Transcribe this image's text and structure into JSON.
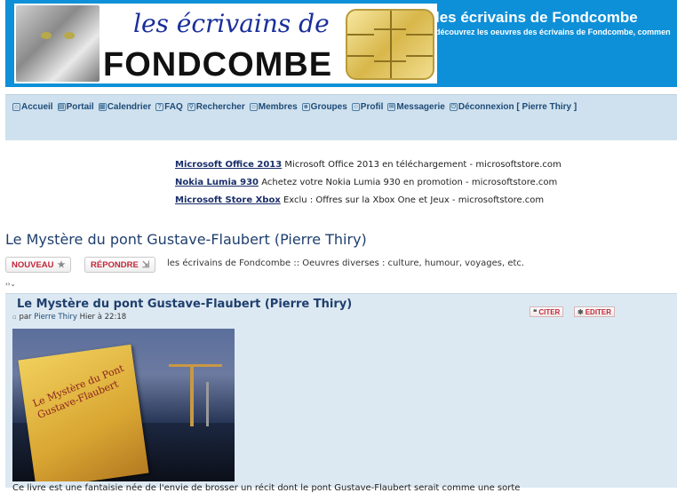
{
  "header": {
    "logo_top_text": "les écrivains de",
    "logo_main_text": "FONDCOMBE",
    "site_title": "les écrivains de Fondcombe",
    "site_subtitle": "découvrez les oeuvres des écrivains de Fondcombe, commen"
  },
  "nav": {
    "items": [
      {
        "label": "Accueil",
        "icon": "home-icon"
      },
      {
        "label": "Portail",
        "icon": "portal-icon"
      },
      {
        "label": "Calendrier",
        "icon": "calendar-icon"
      },
      {
        "label": "FAQ",
        "icon": "faq-icon"
      },
      {
        "label": "Rechercher",
        "icon": "search-icon"
      },
      {
        "label": "Membres",
        "icon": "members-icon"
      },
      {
        "label": "Groupes",
        "icon": "groups-icon"
      },
      {
        "label": "Profil",
        "icon": "profile-icon"
      },
      {
        "label": "Messagerie",
        "icon": "mail-icon"
      },
      {
        "label": "Déconnexion [ Pierre Thiry ]",
        "icon": "logout-icon"
      }
    ]
  },
  "ads": [
    {
      "title": "Microsoft Office 2013",
      "text": "Microsoft Office 2013 en téléchargement -",
      "domain": "microsoftstore.com"
    },
    {
      "title": "Nokia Lumia 930",
      "text": "Achetez votre Nokia Lumia 930 en promotion -",
      "domain": "microsoftstore.com"
    },
    {
      "title": "Microsoft Store Xbox",
      "text": "Exclu : Offres sur la Xbox One et Jeux -",
      "domain": "microsoftstore.com"
    }
  ],
  "topic": {
    "title": "Le Mystère du pont Gustave-Flaubert (Pierre Thiry)",
    "new_button": "NOUVEAU",
    "reply_button": "RÉPONDRE",
    "breadcrumb": "les écrivains de Fondcombe :: Oeuvres diverses : culture, humour, voyages, etc."
  },
  "post": {
    "title": "Le Mystère du pont Gustave-Flaubert (Pierre Thiry)",
    "meta_prefix": "par",
    "author": "Pierre Thiry",
    "time": "Hier à 22:18",
    "quote_button": "CITER",
    "edit_button": "EDITER",
    "cover_text": "Le Mystère du Pont Gustave-Flaubert",
    "body_start": "Ce livre est une fantaisie née de l'envie de brosser un récit dont le pont Gustave-Flaubert serait comme une sorte"
  },
  "colors": {
    "header_bg": "#0e90d8",
    "nav_bg": "#cfe1ee",
    "post_bg": "#dde9f2",
    "accent_red": "#c0273a",
    "link_blue": "#1f3f6e"
  }
}
